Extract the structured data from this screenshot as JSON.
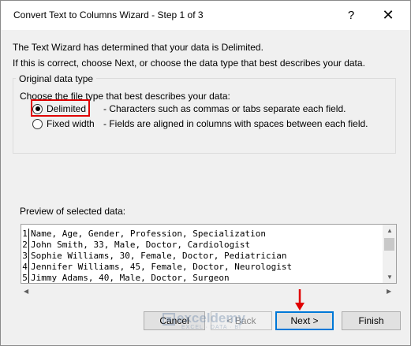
{
  "window": {
    "title": "Convert Text to Columns Wizard - Step 1 of 3",
    "help": "?",
    "close": "✕"
  },
  "intro": {
    "line1": "The Text Wizard has determined that your data is Delimited.",
    "line2": "If this is correct, choose Next, or choose the data type that best describes your data."
  },
  "original_type": {
    "legend": "Original data type",
    "prompt": "Choose the file type that best describes your data:",
    "options": [
      {
        "label": "Delimited",
        "description": "- Characters such as commas or tabs separate each field.",
        "selected": true
      },
      {
        "label": "Fixed width",
        "description": "- Fields are aligned in columns with spaces between each field.",
        "selected": false
      }
    ]
  },
  "preview": {
    "label": "Preview of selected data:",
    "rows": [
      {
        "num": "1",
        "text": "Name, Age, Gender, Profession, Specialization"
      },
      {
        "num": "2",
        "text": "John Smith, 33, Male, Doctor, Cardiologist"
      },
      {
        "num": "3",
        "text": "Sophie Williams, 30, Female, Doctor, Pediatrician"
      },
      {
        "num": "4",
        "text": "Jennifer Williams,  45, Female, Doctor, Neurologist"
      },
      {
        "num": "5",
        "text": "Jimmy Adams, 40, Male, Doctor, Surgeon"
      }
    ]
  },
  "buttons": {
    "cancel": "Cancel",
    "back": "< Back",
    "next": "Next >",
    "finish": "Finish"
  },
  "watermark": {
    "name": "exceldemy",
    "tagline": "EXCEL · DATA · BI"
  },
  "colors": {
    "highlight": "#e00000",
    "accent": "#0078d7"
  }
}
